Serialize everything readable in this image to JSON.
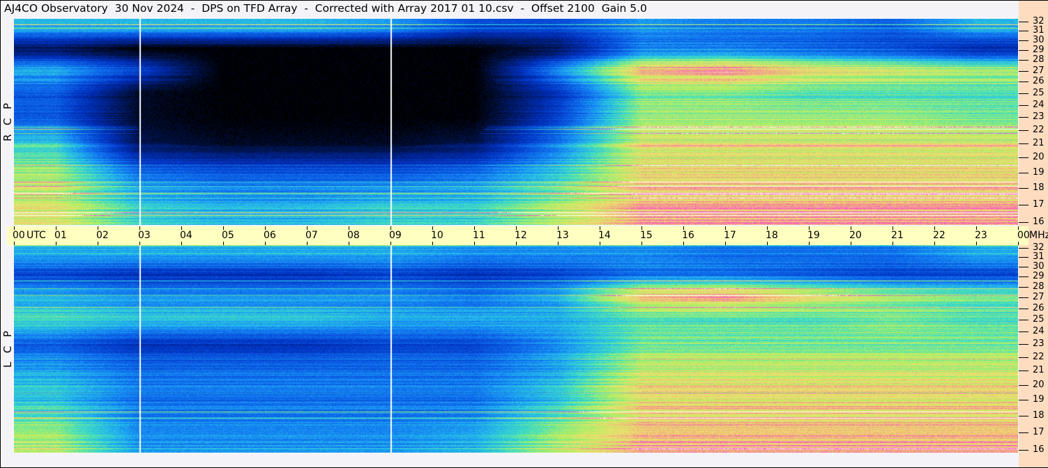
{
  "title": "AJ4CO Observatory  30 Nov 2024  -  DPS on TFD Array  -  Corrected with Array 2017 01 10.csv  -  Offset 2100  Gain 5.0",
  "chart_data": [
    {
      "type": "heatmap",
      "panel_label": "R  C  P",
      "xlabel": "UTC",
      "ylabel": "MHz",
      "xlim": [
        0,
        24
      ],
      "ylim": [
        16,
        32
      ],
      "x_bins_hours": [
        0,
        2,
        4,
        6,
        8,
        10,
        12,
        14,
        16,
        18,
        20,
        22
      ],
      "y_bins_mhz": [
        16,
        18,
        20,
        22,
        24,
        26,
        28,
        30
      ],
      "intensity_scale": [
        0,
        1
      ],
      "intensity": [
        [
          0.75,
          0.55,
          0.5,
          0.5,
          0.55,
          0.55,
          0.7,
          0.85,
          0.85,
          0.85,
          0.85,
          0.85
        ],
        [
          0.7,
          0.4,
          0.35,
          0.35,
          0.35,
          0.4,
          0.55,
          0.8,
          0.8,
          0.8,
          0.8,
          0.8
        ],
        [
          0.55,
          0.1,
          0.05,
          0.05,
          0.05,
          0.1,
          0.4,
          0.75,
          0.75,
          0.75,
          0.75,
          0.75
        ],
        [
          0.35,
          0.05,
          0.0,
          0.0,
          0.0,
          0.0,
          0.3,
          0.7,
          0.7,
          0.7,
          0.7,
          0.65
        ],
        [
          0.35,
          0.05,
          0.0,
          0.0,
          0.0,
          0.0,
          0.25,
          0.65,
          0.65,
          0.6,
          0.6,
          0.6
        ],
        [
          0.5,
          0.3,
          0.0,
          0.0,
          0.0,
          0.0,
          0.45,
          0.85,
          0.9,
          0.8,
          0.75,
          0.7
        ],
        [
          0.1,
          0.0,
          0.0,
          0.0,
          0.0,
          0.0,
          0.1,
          0.4,
          0.4,
          0.35,
          0.3,
          0.2
        ],
        [
          0.5,
          0.5,
          0.5,
          0.5,
          0.45,
          0.3,
          0.3,
          0.45,
          0.4,
          0.4,
          0.35,
          0.5
        ]
      ],
      "marker_lines_hours": [
        3,
        9
      ]
    },
    {
      "type": "heatmap",
      "panel_label": "L  C  P",
      "xlabel": "UTC",
      "ylabel": "MHz",
      "xlim": [
        0,
        24
      ],
      "ylim": [
        16,
        32
      ],
      "x_bins_hours": [
        0,
        2,
        4,
        6,
        8,
        10,
        12,
        14,
        16,
        18,
        20,
        22
      ],
      "y_bins_mhz": [
        16,
        18,
        20,
        22,
        24,
        26,
        28,
        30
      ],
      "intensity_scale": [
        0,
        1
      ],
      "intensity": [
        [
          0.7,
          0.45,
          0.45,
          0.45,
          0.45,
          0.5,
          0.7,
          0.85,
          0.85,
          0.85,
          0.85,
          0.85
        ],
        [
          0.55,
          0.4,
          0.4,
          0.4,
          0.4,
          0.4,
          0.55,
          0.8,
          0.8,
          0.8,
          0.8,
          0.8
        ],
        [
          0.5,
          0.4,
          0.4,
          0.4,
          0.4,
          0.4,
          0.5,
          0.75,
          0.75,
          0.75,
          0.75,
          0.75
        ],
        [
          0.35,
          0.25,
          0.25,
          0.25,
          0.3,
          0.3,
          0.45,
          0.65,
          0.65,
          0.65,
          0.65,
          0.65
        ],
        [
          0.6,
          0.55,
          0.55,
          0.55,
          0.5,
          0.5,
          0.5,
          0.6,
          0.6,
          0.6,
          0.65,
          0.6
        ],
        [
          0.5,
          0.45,
          0.45,
          0.45,
          0.45,
          0.4,
          0.5,
          0.85,
          0.9,
          0.8,
          0.7,
          0.65
        ],
        [
          0.3,
          0.25,
          0.25,
          0.25,
          0.3,
          0.25,
          0.3,
          0.4,
          0.4,
          0.35,
          0.3,
          0.3
        ],
        [
          0.5,
          0.5,
          0.5,
          0.5,
          0.5,
          0.45,
          0.45,
          0.45,
          0.4,
          0.4,
          0.4,
          0.5
        ]
      ],
      "marker_lines_hours": [
        3,
        9
      ]
    }
  ],
  "time_axis": {
    "ticks": [
      "00",
      "01",
      "02",
      "03",
      "04",
      "05",
      "06",
      "07",
      "08",
      "09",
      "10",
      "11",
      "12",
      "13",
      "14",
      "15",
      "16",
      "17",
      "18",
      "19",
      "20",
      "21",
      "22",
      "23",
      "00"
    ],
    "utc_label": "UTC",
    "unit_label": "MHz"
  },
  "freq_axis": {
    "ticks": [
      "32",
      "31",
      "30",
      "29",
      "28",
      "27",
      "26",
      "25",
      "24",
      "23",
      "22",
      "21",
      "20",
      "19",
      "18",
      "17",
      "16"
    ]
  },
  "colormap": [
    "#000000",
    "#0030c0",
    "#1070f0",
    "#20b0f0",
    "#40e0c0",
    "#b0f060",
    "#f0e070",
    "#f0a080",
    "#ff40e0",
    "#ffffff"
  ]
}
